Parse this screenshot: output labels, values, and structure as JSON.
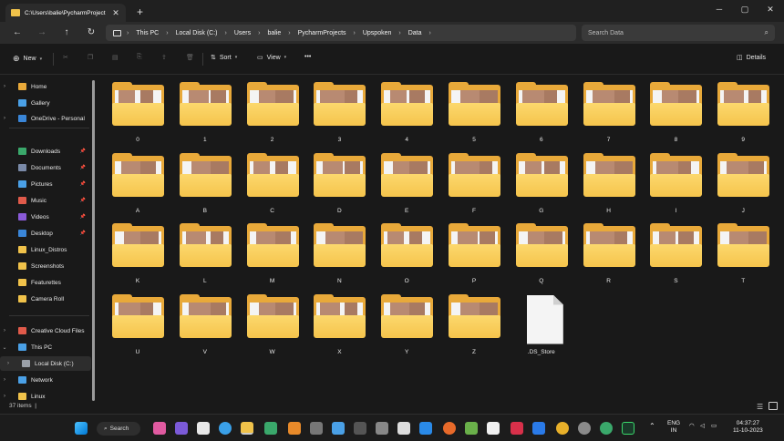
{
  "window": {
    "tab_title": "C:\\Users\\balie\\PycharmProject",
    "minimize": "─",
    "maximize": "▢",
    "close": "✕"
  },
  "nav": {
    "back_icon": "arrow-left-icon",
    "forward_icon": "arrow-right-icon",
    "up_icon": "arrow-up-icon",
    "refresh_icon": "refresh-icon",
    "breadcrumb": [
      "This PC",
      "Local Disk (C:)",
      "Users",
      "balie",
      "PycharmProjects",
      "Upspoken",
      "Data"
    ]
  },
  "search": {
    "placeholder": "Search Data"
  },
  "toolbar": {
    "new_label": "New",
    "sort_label": "Sort",
    "view_label": "View",
    "more_label": "•••",
    "details_label": "Details"
  },
  "sidebar": {
    "items": [
      {
        "label": "Home",
        "color": "#e8a93a"
      },
      {
        "label": "Gallery",
        "color": "#4aa0e6"
      },
      {
        "label": "OneDrive - Personal",
        "color": "#3a86d8"
      },
      {
        "label": "Downloads",
        "color": "#3aa86b"
      },
      {
        "label": "Documents",
        "color": "#7a8aa8"
      },
      {
        "label": "Pictures",
        "color": "#4aa0e6"
      },
      {
        "label": "Music",
        "color": "#e05a4a"
      },
      {
        "label": "Videos",
        "color": "#8a5ad8"
      },
      {
        "label": "Desktop",
        "color": "#3a86d8"
      },
      {
        "label": "Linux_Distros",
        "color": "#f0c24a"
      },
      {
        "label": "Screenshots",
        "color": "#f0c24a"
      },
      {
        "label": "Featurettes",
        "color": "#f0c24a"
      },
      {
        "label": "Camera Roll",
        "color": "#f0c24a"
      },
      {
        "label": "Creative Cloud Files",
        "color": "#e05a4a"
      },
      {
        "label": "This PC",
        "color": "#4aa0e6"
      },
      {
        "label": "Local Disk (C:)",
        "color": "#9aa0a8"
      },
      {
        "label": "Network",
        "color": "#4aa0e6"
      },
      {
        "label": "Linux",
        "color": "#f0c24a"
      }
    ]
  },
  "items": [
    "0",
    "1",
    "2",
    "3",
    "4",
    "5",
    "6",
    "7",
    "8",
    "9",
    "A",
    "B",
    "C",
    "D",
    "E",
    "F",
    "G",
    "H",
    "I",
    "J",
    "K",
    "L",
    "M",
    "N",
    "O",
    "P",
    "Q",
    "R",
    "S",
    "T",
    "U",
    "V",
    "W",
    "X",
    "Y",
    "Z",
    ".DS_Store"
  ],
  "status": {
    "count": "37 items",
    "sep": "|"
  },
  "taskbar": {
    "search_label": "Search",
    "lang": "ENG",
    "region": "IN",
    "time": "04:37:27",
    "date": "11-10-2023"
  },
  "colors": {
    "folder_back": "#e8a93a",
    "folder_front": "#f5c44c",
    "skin": "#b88a72",
    "bg": "#191919"
  }
}
